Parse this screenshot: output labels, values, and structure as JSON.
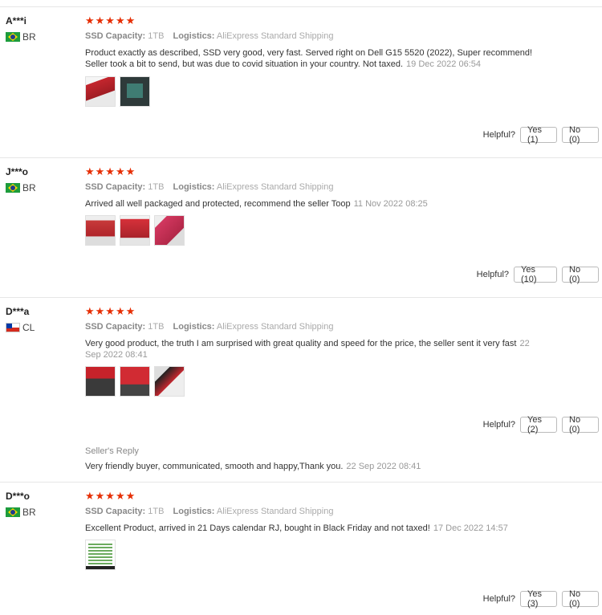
{
  "reviews": [
    {
      "user": "A***i",
      "country": "BR",
      "stars": "★★★★★",
      "capacity_label": "SSD Capacity:",
      "capacity_value": "1TB",
      "logistics_label": "Logistics:",
      "logistics_value": "AliExpress Standard Shipping",
      "text": "Product exactly as described, SSD very good, very fast. Served right on Dell G15 5520 (2022), Super recommend! Seller took a bit to send, but was due to covid situation in your country. Not taxed.",
      "date": "19 Dec 2022 06:54",
      "helpful_label": "Helpful?",
      "yes_label": "Yes (1)",
      "no_label": "No (0)"
    },
    {
      "user": "J***o",
      "country": "BR",
      "stars": "★★★★★",
      "capacity_label": "SSD Capacity:",
      "capacity_value": "1TB",
      "logistics_label": "Logistics:",
      "logistics_value": "AliExpress Standard Shipping",
      "text": "Arrived all well packaged and protected, recommend the seller Toop",
      "date": "11 Nov 2022 08:25",
      "helpful_label": "Helpful?",
      "yes_label": "Yes (10)",
      "no_label": "No (0)"
    },
    {
      "user": "D***a",
      "country": "CL",
      "stars": "★★★★★",
      "capacity_label": "SSD Capacity:",
      "capacity_value": "1TB",
      "logistics_label": "Logistics:",
      "logistics_value": "AliExpress Standard Shipping",
      "text": "Very good product, the truth I am surprised with great quality and speed for the price, the seller sent it very fast",
      "date": "22 Sep 2022 08:41",
      "helpful_label": "Helpful?",
      "yes_label": "Yes (2)",
      "no_label": "No (0)",
      "reply_title": "Seller's Reply",
      "reply_text": "Very friendly buyer, communicated, smooth and happy,Thank you.",
      "reply_date": "22 Sep 2022 08:41"
    },
    {
      "user": "D***o",
      "country": "BR",
      "stars": "★★★★★",
      "capacity_label": "SSD Capacity:",
      "capacity_value": "1TB",
      "logistics_label": "Logistics:",
      "logistics_value": "AliExpress Standard Shipping",
      "text": "Excellent Product, arrived in 21 Days calendar RJ, bought in Black Friday and not taxed!",
      "date": "17 Dec 2022 14:57",
      "helpful_label": "Helpful?",
      "yes_label": "Yes (3)",
      "no_label": "No (0)"
    }
  ],
  "colors": {
    "star": "#e62e04",
    "border": "#e6e6e6"
  }
}
